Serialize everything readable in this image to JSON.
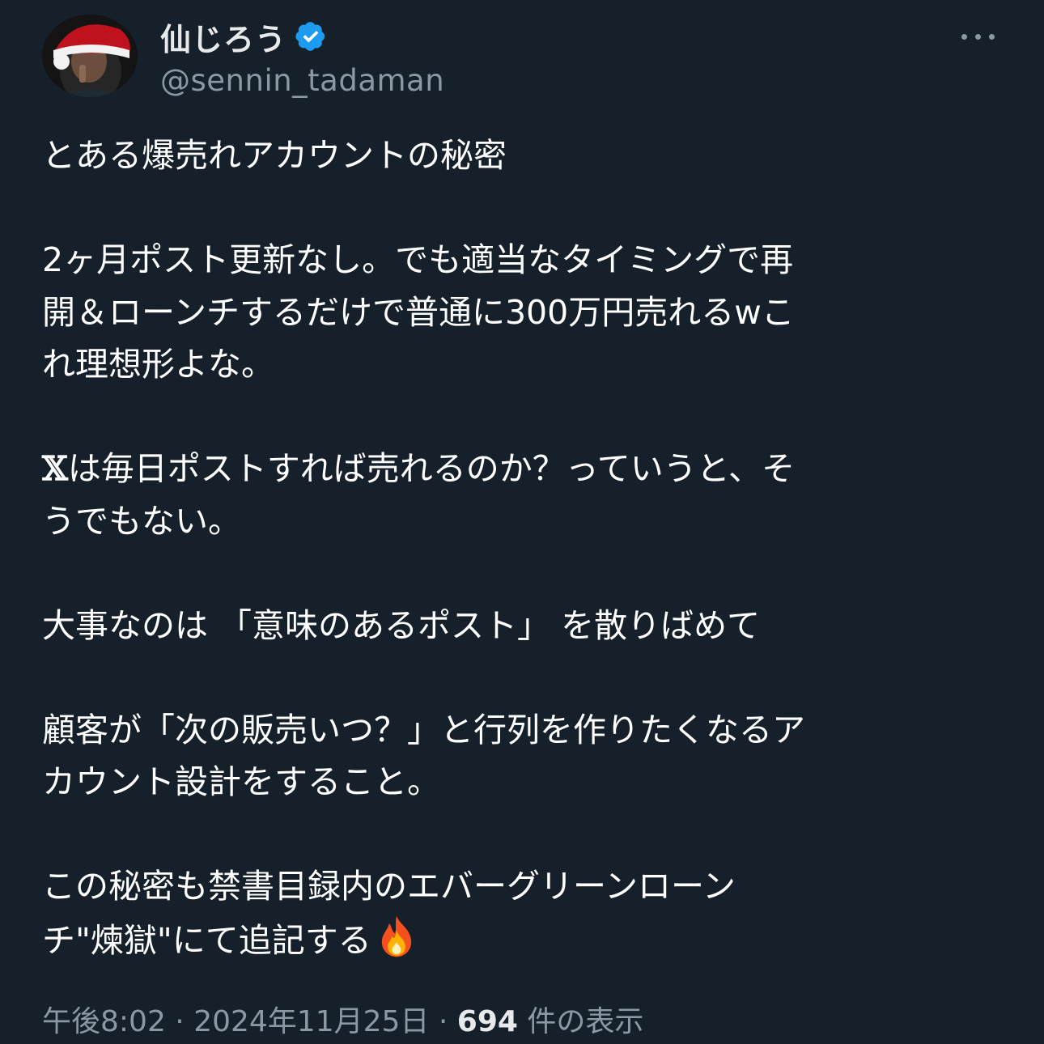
{
  "author": {
    "display_name": "仙じろう",
    "handle": "@sennin_tadaman",
    "verified_icon": "verified-badge-icon",
    "avatar_icon": "user-avatar-santa-hat"
  },
  "more_icon": "more-horizontal-icon",
  "post": {
    "line1": "とある爆売れアカウントの秘密",
    "line2": "2ヶ月ポスト更新なし。でも適当なタイミングで再",
    "line3": "開＆ローンチするだけで普通に300万円売れるwこ",
    "line4": "れ理想形よな。",
    "line5_logo": "𝕏",
    "line5_text": "は毎日ポストすれば売れるのか？っていうと、そ",
    "line6": "うでもない。",
    "line7": "大事なのは 「意味のあるポスト」 を散りばめて",
    "line8": "顧客が「次の販売いつ？」と行列を作りたくなるア",
    "line9": "カウント設計をすること。",
    "line10": "この秘密も禁書目録内のエバーグリーンローン",
    "line11": "チ\"煉獄\"にて追記する",
    "fire_icon": "fire-emoji-icon"
  },
  "meta": {
    "time": "午後8:02",
    "sep1": " · ",
    "date": "2024年11月25日",
    "sep2": " · ",
    "views": "694",
    "views_label": " 件の表示"
  },
  "colors": {
    "background": "#15202b",
    "text": "#ffffff",
    "secondary": "#8b98a5",
    "verified": "#1d9bf0"
  }
}
